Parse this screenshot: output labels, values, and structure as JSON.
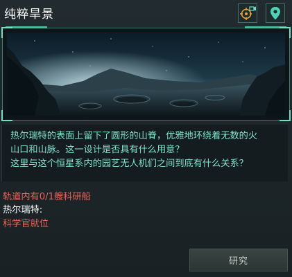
{
  "window": {
    "title": "纯粹旱景"
  },
  "toolbar": {
    "target_icon": "crosshair-camera-icon",
    "location_icon": "map-pin-icon",
    "accent": "#6fe0c4"
  },
  "description": [
    "热尔瑞特的表面上留下了圆形的山脊，优雅地环绕着无数的火",
    "山口和山脉。这一设计是否具有什么用意？",
    "这里与这个恒星系内的园艺无人机们之间到底有什么关系？"
  ],
  "requirements": {
    "ship": "轨道内有0/1艘科研船",
    "planet_label": "热尔瑞特:",
    "officer": "科学官就位"
  },
  "actions": {
    "research_label": "研究"
  },
  "colors": {
    "text_accent": "#7fe3cf",
    "warning": "#e86558",
    "frame": "#3e7e70"
  }
}
